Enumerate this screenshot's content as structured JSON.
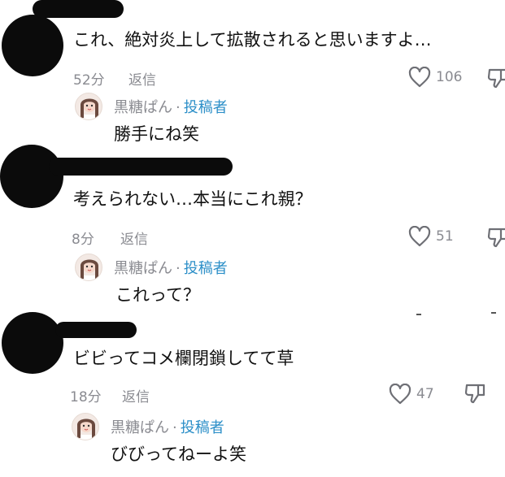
{
  "comments": [
    {
      "text": "これ、絶対炎上して拡散されると思いますよ…",
      "time": "52分",
      "reply_label": "返信",
      "likes": "106",
      "reply": {
        "author": "黒糖ぱん",
        "separator": "·",
        "badge": "投稿者",
        "text": "勝手にね笑"
      }
    },
    {
      "text": "考えられない…本当にこれ親？",
      "time": "8分",
      "reply_label": "返信",
      "likes": "51",
      "reply": {
        "author": "黒糖ぱん",
        "separator": "·",
        "badge": "投稿者",
        "text": "これって？"
      }
    },
    {
      "text": "ビビってコメ欄閉鎖してて草",
      "time": "18分",
      "reply_label": "返信",
      "likes": "47",
      "reply": {
        "author": "黒糖ぱん",
        "separator": "·",
        "badge": "投稿者",
        "text": "びびってねーよ笑"
      }
    }
  ],
  "icons": {
    "like": "heart-icon",
    "dislike": "dislike-icon",
    "avatar": "avatar"
  },
  "colors": {
    "meta": "#8a8b91",
    "author_badge": "#2c8fc8",
    "text": "#111111"
  }
}
